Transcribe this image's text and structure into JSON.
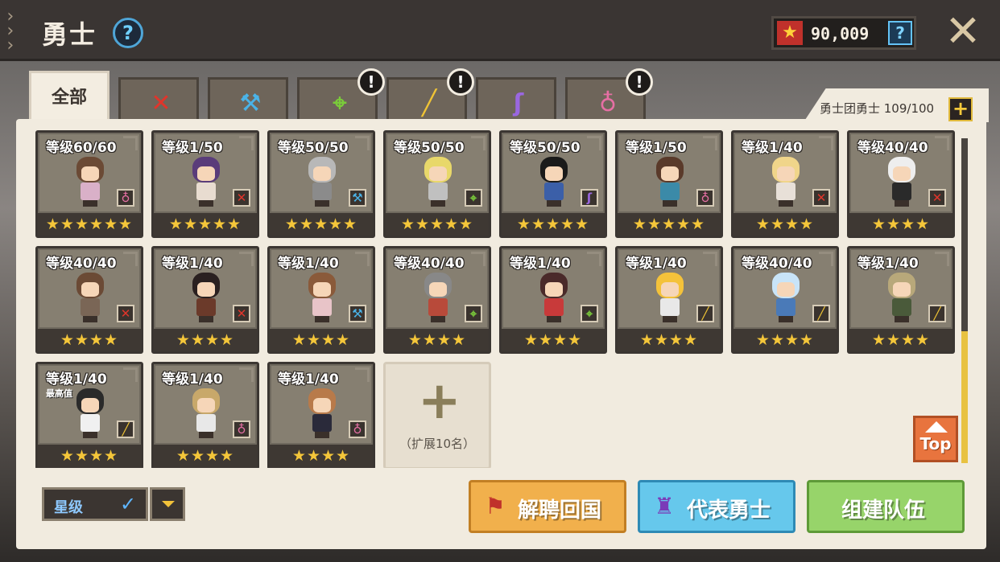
{
  "header": {
    "title": "勇士",
    "help_symbol": "?",
    "currency_value": "90,009",
    "currency_help_symbol": "?",
    "close_symbol": "✕"
  },
  "tabs": [
    {
      "label": "全部",
      "icon": "all",
      "active": true,
      "alert": false
    },
    {
      "label": "",
      "icon": "sword-icon",
      "glyph": "✕",
      "color": "#e0352b",
      "alert": false
    },
    {
      "label": "",
      "icon": "hammer-icon",
      "glyph": "⚒",
      "color": "#4ab3e8",
      "alert": false
    },
    {
      "label": "",
      "icon": "bow-icon",
      "glyph": "⌖",
      "color": "#7acb3a",
      "alert": true
    },
    {
      "label": "",
      "icon": "gun-icon",
      "glyph": "╱",
      "color": "#f0c435",
      "alert": true
    },
    {
      "label": "",
      "icon": "staff-icon",
      "glyph": "ʃ",
      "color": "#9a67e0",
      "alert": false
    },
    {
      "label": "",
      "icon": "orb-icon",
      "glyph": "♁",
      "color": "#e66fa4",
      "alert": true
    }
  ],
  "alert_symbol": "!",
  "roster": {
    "text": "勇士团勇士 109/100",
    "add_symbol": "+"
  },
  "heroes": [
    {
      "level": "等级60/60",
      "stars": "★★★★★★",
      "weapon": "orb",
      "hair": "#6b4a35",
      "body": "#d9b0c8",
      "max": ""
    },
    {
      "level": "等级1/50",
      "stars": "★★★★★",
      "weapon": "sword",
      "hair": "#5a3c7a",
      "body": "#e8dcd0",
      "max": ""
    },
    {
      "level": "等级50/50",
      "stars": "★★★★★",
      "weapon": "hammer",
      "hair": "#b8b8b8",
      "body": "#8b8b8b",
      "max": ""
    },
    {
      "level": "等级50/50",
      "stars": "★★★★★",
      "weapon": "bow",
      "hair": "#e8d86a",
      "body": "#c0c0c0",
      "max": ""
    },
    {
      "level": "等级50/50",
      "stars": "★★★★★",
      "weapon": "staff",
      "hair": "#1a1a1a",
      "body": "#3b5fa8",
      "max": ""
    },
    {
      "level": "等级1/50",
      "stars": "★★★★★",
      "weapon": "orb",
      "hair": "#5a3a2a",
      "body": "#3b8aa8",
      "max": ""
    },
    {
      "level": "等级1/40",
      "stars": "★★★★",
      "weapon": "sword",
      "hair": "#f0d58a",
      "body": "#e8e0d8",
      "max": ""
    },
    {
      "level": "等级40/40",
      "stars": "★★★★",
      "weapon": "sword",
      "hair": "#eeeeee",
      "body": "#2a2a2a",
      "max": ""
    },
    {
      "level": "等级40/40",
      "stars": "★★★★",
      "weapon": "sword",
      "hair": "#6b4a35",
      "body": "#7a6656",
      "max": ""
    },
    {
      "level": "等级1/40",
      "stars": "★★★★",
      "weapon": "sword",
      "hair": "#2a2020",
      "body": "#6b3a2a",
      "max": ""
    },
    {
      "level": "等级1/40",
      "stars": "★★★★",
      "weapon": "hammer",
      "hair": "#8a5a3a",
      "body": "#e8c4c8",
      "max": ""
    },
    {
      "level": "等级40/40",
      "stars": "★★★★",
      "weapon": "bow",
      "hair": "#888888",
      "body": "#b84a3a",
      "max": ""
    },
    {
      "level": "等级1/40",
      "stars": "★★★★",
      "weapon": "bow",
      "hair": "#4a2a2a",
      "body": "#c83a3a",
      "max": ""
    },
    {
      "level": "等级1/40",
      "stars": "★★★★",
      "weapon": "gun",
      "hair": "#f4c23a",
      "body": "#e8e8e8",
      "max": ""
    },
    {
      "level": "等级40/40",
      "stars": "★★★★",
      "weapon": "gun",
      "hair": "#c8e4f8",
      "body": "#4a7ab8",
      "max": ""
    },
    {
      "level": "等级1/40",
      "stars": "★★★★",
      "weapon": "gun",
      "hair": "#b8a87a",
      "body": "#4a5a3a",
      "max": ""
    },
    {
      "level": "等级1/40",
      "stars": "★★★★",
      "weapon": "gun",
      "hair": "#2a2a2a",
      "body": "#f0f0f0",
      "max": "最高值"
    },
    {
      "level": "等级1/40",
      "stars": "★★★★",
      "weapon": "orb",
      "hair": "#c8a86a",
      "body": "#e8e8e8",
      "max": ""
    },
    {
      "level": "等级1/40",
      "stars": "★★★★",
      "weapon": "orb",
      "hair": "#b87a4a",
      "body": "#2a2a3a",
      "max": ""
    }
  ],
  "expand": {
    "plus": "+",
    "label": "（扩展10名）"
  },
  "top_button": {
    "label": "Top"
  },
  "sort": {
    "label": "星级",
    "check": "✓"
  },
  "actions": {
    "dismiss": "解聘回国",
    "representative": "代表勇士",
    "team": "组建队伍"
  },
  "weapon_colors": {
    "sword": "#e0352b",
    "hammer": "#4ab3e8",
    "bow": "#7acb3a",
    "gun": "#f0c435",
    "staff": "#9a67e0",
    "orb": "#e66fa4"
  },
  "weapon_glyphs": {
    "sword": "✕",
    "hammer": "⚒",
    "bow": "⌖",
    "gun": "╱",
    "staff": "ʃ",
    "orb": "♁"
  }
}
